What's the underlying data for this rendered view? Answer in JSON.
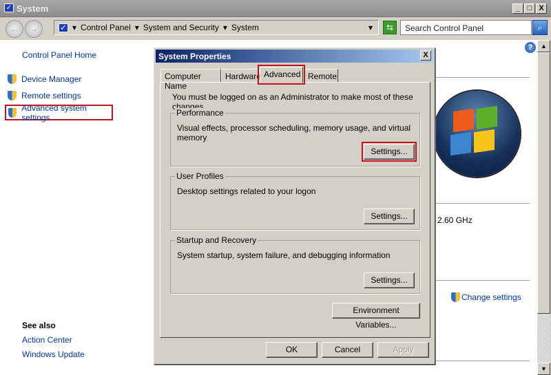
{
  "window": {
    "title": "System",
    "min": "_",
    "max": "□",
    "close": "X"
  },
  "address": {
    "crumbs": [
      "Control Panel",
      "System and Security",
      "System"
    ],
    "search_placeholder": "Search Control Panel"
  },
  "sidebar": {
    "home": "Control Panel Home",
    "items": [
      {
        "label": "Device Manager"
      },
      {
        "label": "Remote settings"
      },
      {
        "label": "Advanced system settings"
      }
    ],
    "see_also_title": "See also",
    "see_also": [
      "Action Center",
      "Windows Update"
    ]
  },
  "main": {
    "processor_speed": "2.60 GHz",
    "change_settings": "Change settings"
  },
  "dialog": {
    "title": "System Properties",
    "tabs": [
      "Computer Name",
      "Hardware",
      "Advanced",
      "Remote"
    ],
    "active_tab": "Advanced",
    "admin_note": "You must be logged on as an Administrator to make most of these changes.",
    "groups": [
      {
        "title": "Performance",
        "desc": "Visual effects, processor scheduling, memory usage, and virtual memory",
        "button": "Settings..."
      },
      {
        "title": "User Profiles",
        "desc": "Desktop settings related to your logon",
        "button": "Settings..."
      },
      {
        "title": "Startup and Recovery",
        "desc": "System startup, system failure, and debugging information",
        "button": "Settings..."
      }
    ],
    "env_button": "Environment Variables...",
    "ok": "OK",
    "cancel": "Cancel",
    "apply": "Apply"
  },
  "colors": {
    "highlight": "#c0141c",
    "link": "#0033aa"
  }
}
